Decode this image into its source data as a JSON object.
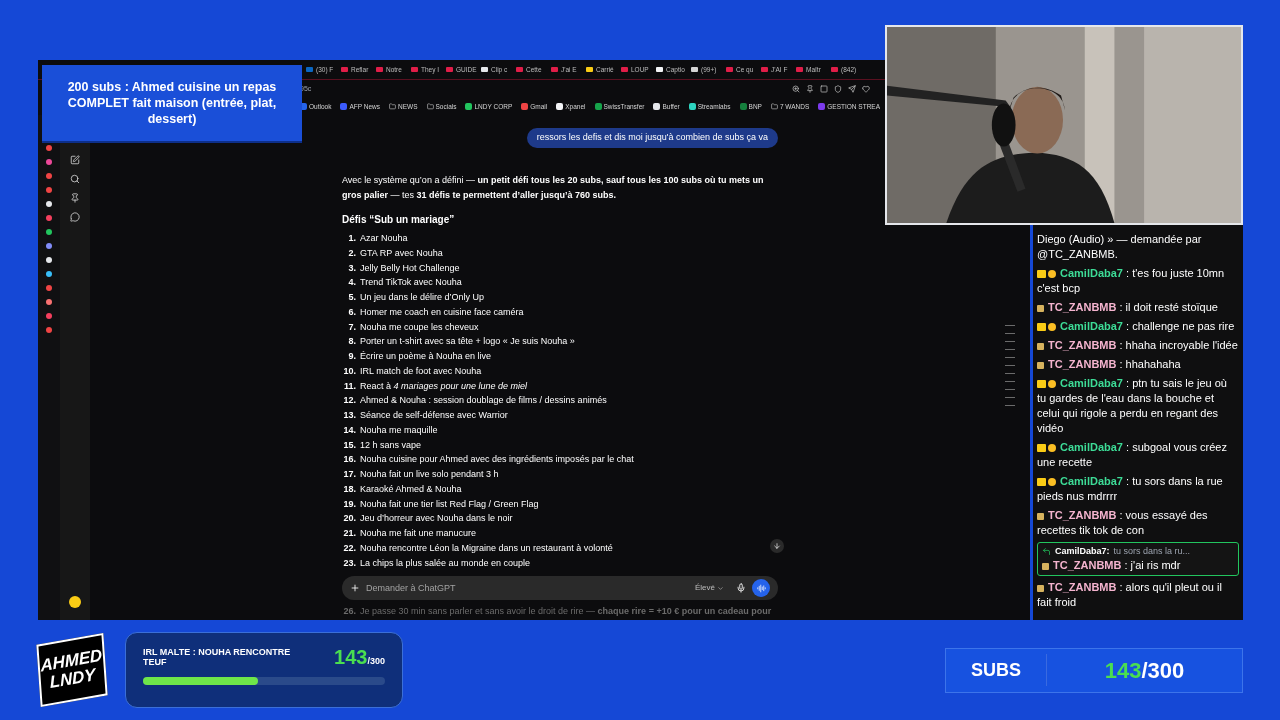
{
  "overlay_title": "200 subs : Ahmed cuisine un repas COMPLET fait maison (entrée, plat, dessert)",
  "browser": {
    "tabs": [
      {
        "label": "(30) F",
        "color": "#0a66c2"
      },
      {
        "label": "Reflar",
        "color": "#e11d48"
      },
      {
        "label": "Notre",
        "color": "#e11d48"
      },
      {
        "label": "They I",
        "color": "#e11d48"
      },
      {
        "label": "GUIDE",
        "color": "#e11d48"
      },
      {
        "label": "Clip c",
        "color": "#e5e7eb"
      },
      {
        "label": "Cette",
        "color": "#e11d48"
      },
      {
        "label": "J'ai E",
        "color": "#e11d48"
      },
      {
        "label": "Carrié",
        "color": "#facc15"
      },
      {
        "label": "LOUP",
        "color": "#e11d48"
      },
      {
        "label": "Captio",
        "color": "#f3f4f6"
      },
      {
        "label": "(99+)",
        "color": "#d4d4d4"
      },
      {
        "label": "Ce qu",
        "color": "#e11d48"
      },
      {
        "label": "J'AI F",
        "color": "#e11d48"
      },
      {
        "label": "Maîtr",
        "color": "#e11d48"
      },
      {
        "label": "(842)",
        "color": "#e11d48"
      }
    ],
    "address": "95c",
    "bookmarks": [
      {
        "label": "Outlook",
        "kind": "link",
        "color": "#2563eb"
      },
      {
        "label": "AFP News",
        "kind": "link",
        "color": "#3b5bfd"
      },
      {
        "label": "NEWS",
        "kind": "folder"
      },
      {
        "label": "Socials",
        "kind": "folder"
      },
      {
        "label": "LNDY CORP",
        "kind": "link",
        "color": "#22c55e"
      },
      {
        "label": "Gmail",
        "kind": "link",
        "color": "#ef4444"
      },
      {
        "label": "Xpanel",
        "kind": "link",
        "color": "#f3f4f6"
      },
      {
        "label": "SwissTransfer",
        "kind": "link",
        "color": "#16a34a"
      },
      {
        "label": "Buffer",
        "kind": "link",
        "color": "#e5e7eb"
      },
      {
        "label": "Streamlabs",
        "kind": "link",
        "color": "#2dd4bf"
      },
      {
        "label": "BNP",
        "kind": "link",
        "color": "#15803d"
      },
      {
        "label": "7 WANDS",
        "kind": "folder"
      },
      {
        "label": "GESTION STREA",
        "kind": "link",
        "color": "#7c3aed"
      }
    ]
  },
  "chat": {
    "user_message": "ressors les defis et dis moi jusqu'à combien de subs ça va",
    "intro": "Avec le système qu’on a défini — **un petit défi tous les 20 subs, sauf tous les 100 subs où tu mets un gros palier** — tes **31 défis te permettent d’aller jusqu’à 760 subs.**",
    "heading": "Défis “Sub un mariage”",
    "items": [
      {
        "number": "1.",
        "text": "Azar Nouha"
      },
      {
        "number": "2.",
        "text": "GTA RP avec Nouha"
      },
      {
        "number": "3.",
        "text": "Jelly Belly Hot Challenge"
      },
      {
        "number": "4.",
        "text": "Trend TikTok avec Nouha"
      },
      {
        "number": "5.",
        "text": "Un jeu dans le délire d’Only Up"
      },
      {
        "number": "6.",
        "text": "Homer me coach en cuisine face caméra"
      },
      {
        "number": "7.",
        "text": "Nouha me coupe les cheveux"
      },
      {
        "number": "8.",
        "text": "Porter un t-shirt avec sa tête + logo « Je suis Nouha »"
      },
      {
        "number": "9.",
        "text": "Écrire un poème à Nouha en live"
      },
      {
        "number": "10.",
        "text": "IRL match de foot avec Nouha"
      },
      {
        "number": "11.",
        "text": "React à *4 mariages pour une lune de miel*"
      },
      {
        "number": "12.",
        "text": "Ahmed & Nouha : session doublage de films / dessins animés"
      },
      {
        "number": "13.",
        "text": "Séance de self-défense avec Warrior"
      },
      {
        "number": "14.",
        "text": "Nouha me maquille"
      },
      {
        "number": "15.",
        "text": "12 h sans vape"
      },
      {
        "number": "16.",
        "text": "Nouha cuisine pour Ahmed avec des ingrédients imposés par le chat"
      },
      {
        "number": "17.",
        "text": "Nouha fait un live solo pendant 3 h"
      },
      {
        "number": "18.",
        "text": "Karaoké Ahmed & Nouha"
      },
      {
        "number": "19.",
        "text": "Nouha fait une tier list Red Flag / Green Flag"
      },
      {
        "number": "20.",
        "text": "Jeu d’horreur avec Nouha dans le noir"
      },
      {
        "number": "21.",
        "text": "Nouha me fait une manucure"
      },
      {
        "number": "22.",
        "text": "Nouha rencontre Léon la Migraine dans un restaurant à volonté"
      },
      {
        "number": "23.",
        "text": "La chips la plus salée au monde en couple"
      }
    ],
    "composer": {
      "placeholder": "Demander à ChatGPT",
      "model": "Élevé"
    },
    "below_item": {
      "number": "26.",
      "text": "Je passe 30 min sans parler et sans avoir le droit de rire — **chaque rire = +10 € pour un cadeau pour**"
    }
  },
  "stream_chat": [
    {
      "kind": "fragment",
      "text": "Diego (Audio) » — demandée par @TC_ZANBMB."
    },
    {
      "kind": "message",
      "user": "CamilDaba7",
      "color": "#3ddc97",
      "subscriber": true,
      "text": ": t'es fou juste 10mn c'est bcp"
    },
    {
      "kind": "message",
      "user": "TC_ZANBMB",
      "color": "#f5b4cf",
      "subscriber": false,
      "text": ": il doit resté stoïque"
    },
    {
      "kind": "message",
      "user": "CamilDaba7",
      "color": "#3ddc97",
      "subscriber": true,
      "text": ": challenge ne pas rire"
    },
    {
      "kind": "message",
      "user": "TC_ZANBMB",
      "color": "#f5b4cf",
      "subscriber": false,
      "text": ": hhaha incroyable l'idée"
    },
    {
      "kind": "message",
      "user": "TC_ZANBMB",
      "color": "#f5b4cf",
      "subscriber": false,
      "text": ": hhahahaha"
    },
    {
      "kind": "message",
      "user": "CamilDaba7",
      "color": "#3ddc97",
      "subscriber": true,
      "text": ": ptn tu sais le jeu où tu gardes de l'eau dans la bouche et celui qui rigole a perdu en regant des vidéo"
    },
    {
      "kind": "message",
      "user": "CamilDaba7",
      "color": "#3ddc97",
      "subscriber": true,
      "text": ": subgoal vous créez une recette"
    },
    {
      "kind": "message",
      "user": "CamilDaba7",
      "color": "#3ddc97",
      "subscriber": true,
      "text": ": tu sors dans la rue pieds nus mdrrrr"
    },
    {
      "kind": "message",
      "user": "TC_ZANBMB",
      "color": "#f5b4cf",
      "subscriber": false,
      "text": ": vous essayé des recettes tik tok de con"
    },
    {
      "kind": "reply",
      "reply_to": "CamilDaba7:",
      "reply_text": "tu sors dans la ru...",
      "user": "TC_ZANBMB",
      "color": "#f5b4cf",
      "subscriber": false,
      "text": ": j'ai ris mdr"
    },
    {
      "kind": "message",
      "user": "TC_ZANBMB",
      "color": "#f5b4cf",
      "subscriber": false,
      "text": ": alors qu'il pleut ou il fait froid"
    }
  ],
  "logo": {
    "line_1": "AHMED",
    "line_2": "LNDY"
  },
  "goal": {
    "title": "IRL MALTE : NOUHA RENCONTRE TEUF",
    "current": "143",
    "total": "/300",
    "level": 0.477
  },
  "subs": {
    "label": "SUBS",
    "current": "143",
    "total": "/300"
  }
}
